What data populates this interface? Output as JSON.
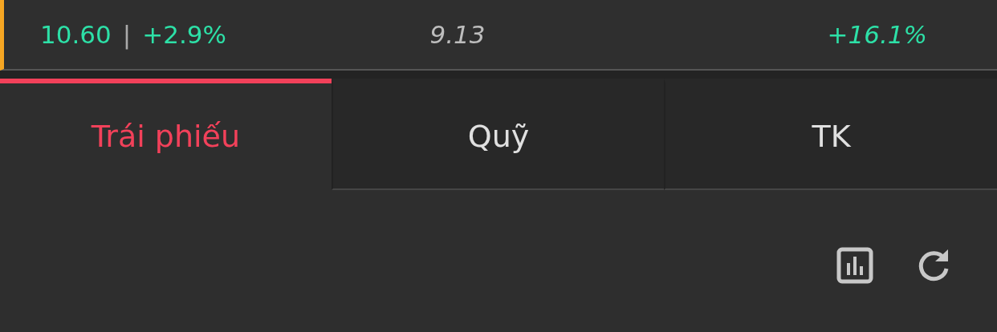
{
  "ticker": {
    "price": "10.60",
    "separator": "|",
    "change": "+2.9%",
    "value": "9.13",
    "return": "+16.1%"
  },
  "tabs": [
    {
      "label": "Trái phiếu",
      "selected": true
    },
    {
      "label": "Quỹ",
      "selected": false
    },
    {
      "label": "TK",
      "selected": false
    }
  ],
  "toolbar": [
    {
      "kind": "chart"
    },
    {
      "kind": "refresh"
    }
  ]
}
